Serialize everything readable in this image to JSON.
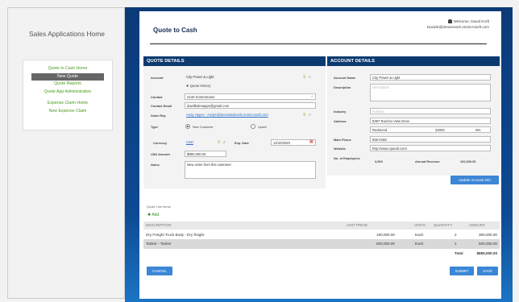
{
  "sidebar": {
    "title": "Sales Applications Home",
    "items": [
      {
        "label": "Quote to Cash Home"
      },
      {
        "label": "New Quote"
      },
      {
        "label": "Quote Reports"
      },
      {
        "label": "Quote App Administration"
      },
      {
        "label": "Expense Claim Home"
      },
      {
        "label": "New Expense Claim"
      }
    ]
  },
  "header": {
    "title": "Quote to Cash",
    "welcome": "Welcome, David Kroft",
    "email": "DavidK@dreamwork.onmicrosoft.com"
  },
  "quote": {
    "section": "QUOTE DETAILS",
    "account_label": "Account",
    "account": "City Power & Light",
    "quote_history": "Quote History",
    "contact_label": "Contact",
    "contact": "Scott Konersmann",
    "contact_email_label": "Contact Email",
    "contact_email": "davidkidesapps@gmail.com",
    "sales_rep_label": "Sales Rep",
    "sales_rep": "Andy Hayes - AndyH@demokitdevelo.onmicrosoft.com",
    "type_label": "Type",
    "type_new": "New Customer",
    "type_upsell": "Upsell",
    "currency_label": "Currency",
    "currency": "USD",
    "exp_date_label": "Exp. Date",
    "exp_date": "12/10/2020",
    "usd_amount_label": "USD Amount",
    "usd_amount": "$860,000.00",
    "notes_label": "Notes",
    "notes": "New order from this customer"
  },
  "account": {
    "section": "ACCOUNT DETAILS",
    "name_label": "Account Name",
    "name": "City Power & Light",
    "desc_label": "Description",
    "desc_placeholder": "Description",
    "industry_label": "Industry",
    "industry_placeholder": "Industry",
    "address_label": "Address",
    "street": "5397 Rancho View Drive",
    "city": "Redmond",
    "zip": "32000",
    "state": "WA",
    "phone_label": "Main Phone",
    "phone": "555-0158",
    "website_label": "Website",
    "website": "http://www.cpandl.com/",
    "employees_label": "No. of Employees",
    "employees": "3,900",
    "revenue_label": "Annual Revenue",
    "revenue": "100,000.00",
    "update_button": "Update Account Info"
  },
  "lines": {
    "title": "Quote Line Items",
    "add": "Add",
    "headers": {
      "description": "DESCRIPTION",
      "unit_price": "UNIT PRICE",
      "units": "UNITS",
      "quantity": "QUANTITY",
      "amount": "AMOUNT"
    },
    "rows": [
      {
        "description": "Dry Freight Truck Body - Dry freight",
        "unit_price": "180,000.00",
        "units": "Each",
        "quantity": "2",
        "amount": "360,000.00"
      },
      {
        "description": "Tanker - Tanker",
        "unit_price": "500,000.00",
        "units": "Each",
        "quantity": "1",
        "amount": "500,000.00"
      }
    ],
    "total_label": "Total",
    "total": "$860,000.00"
  },
  "actions": {
    "cancel": "CANCEL",
    "submit": "SUBMIT",
    "save": "SAVE"
  },
  "colors": {
    "accent": "#3b86d6",
    "nav_text": "#4b9a1e",
    "section_bg": "#0c3a6f"
  }
}
